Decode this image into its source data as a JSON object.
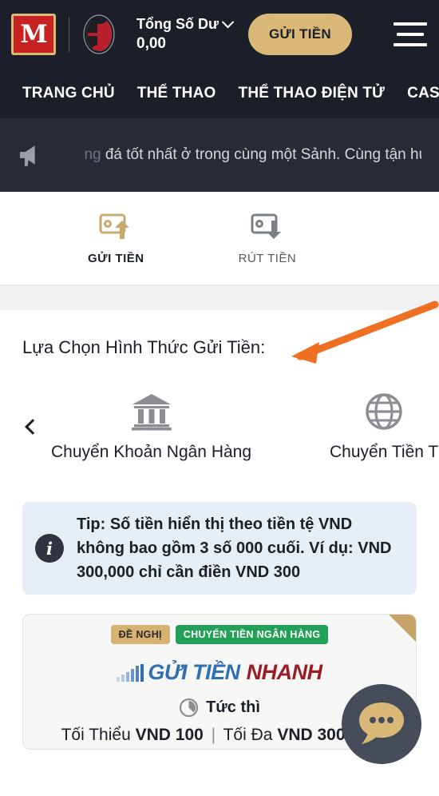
{
  "header": {
    "logo_alt": "M",
    "balance_label": "Tổng Số Dư",
    "balance_value": "0,00",
    "deposit_button": "GỬI TIỀN"
  },
  "nav": {
    "items": [
      {
        "label": "TRANG CHỦ"
      },
      {
        "label": "THỂ THAO"
      },
      {
        "label": "THỂ THAO ĐIỆN TỬ"
      },
      {
        "label": "CASINO"
      }
    ]
  },
  "announcement": {
    "text_dim": "ng",
    "text": "đá tốt nhất ở trong cùng một Sảnh. Cùng tận hu"
  },
  "tabs": [
    {
      "label": "GỬI TIỀN",
      "active": true
    },
    {
      "label": "RÚT TIỀN",
      "active": false
    }
  ],
  "section": {
    "choose_title": "Lựa Chọn Hình Thức Gửi Tiền:"
  },
  "methods": [
    {
      "label": "Chuyển Khoản Ngân Hàng",
      "icon": "bank-icon"
    },
    {
      "label": "Chuyển Tiền T",
      "icon": "globe-icon"
    }
  ],
  "tip": {
    "line1": "Tip: Số tiền hiển thị theo tiền tệ VND",
    "line2": "không bao gồm 3 số 000 cuối. Ví dụ: VND",
    "line3": "300,000 chỉ cần điền VND 300"
  },
  "card": {
    "badge_recommended": "ĐỀ NGHỊ",
    "badge_method": "CHUYỂN TIỀN NGÂN HÀNG",
    "brand_part1": "GỬI TIỀN",
    "brand_part2": "NHANH",
    "speed": "Tức thì",
    "min_label": "Tối Thiểu",
    "min_value": "VND 100",
    "separator": "|",
    "max_label": "Tối Đa",
    "max_value": "VND 300.000"
  },
  "chat": {
    "label": "chat-bubble"
  },
  "colors": {
    "dark": "#1b1f2a",
    "gold": "#d9b878",
    "green": "#23a058",
    "tip_bg": "#e8eef7",
    "arrow": "#ef7023",
    "brand_blue": "#2f6fb5",
    "brand_red": "#9c1c26"
  }
}
